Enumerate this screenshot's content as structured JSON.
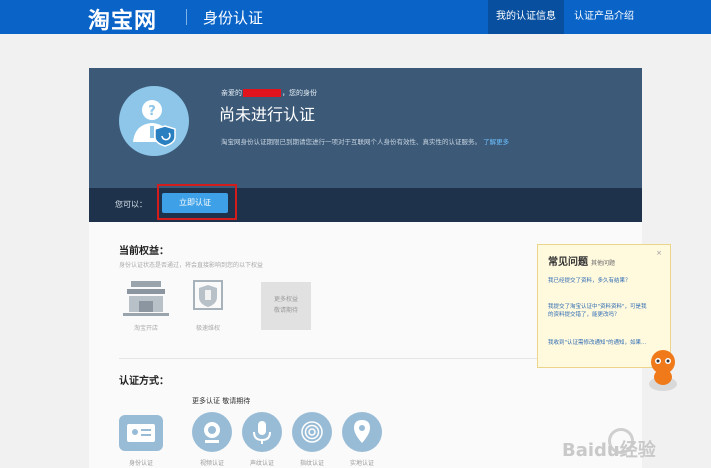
{
  "header": {
    "logo": "淘宝网",
    "subtitle": "身份认证",
    "nav": [
      "我的认证信息",
      "认证产品介绍"
    ],
    "brand_color": "#0a64c8"
  },
  "status": {
    "greeting_prefix": "亲爱的",
    "greeting_suffix": "，您的身份",
    "title": "尚未进行认证",
    "description": "淘宝网身份认证期限已到期请您进行一项对于互联网个人身份有效性、真实性的认证服务。",
    "more_link": "了解更多"
  },
  "action": {
    "label": "您可以：",
    "button": "立即认证"
  },
  "benefits": {
    "title": "当前权益：",
    "subtitle": "身份认证状态是否通过，将会直接影响到您的以下权益",
    "items": [
      "淘宝开店",
      "极速维权"
    ],
    "more_line1": "更多权益",
    "more_line2": "敬请期待"
  },
  "methods": {
    "title": "认证方式：",
    "more": "更多认证  敬请期待",
    "items": [
      "身份认证",
      "视频认证",
      "声纹认证",
      "指纹认证",
      "实地认证"
    ]
  },
  "faq": {
    "close": "×",
    "title": "常见问题",
    "title_sub": "其他问题",
    "items": [
      "我已经提交了资料，多久有结果？",
      "我提交了淘宝认证中\"资料资料\"，可是我的资料提交错了，能更改吗？",
      "我收到\"认证需修改通知\"的通知，如果…"
    ]
  },
  "watermark": "Baidu经验",
  "colors": {
    "card": "#3c5a78",
    "action_bar": "#1e334b",
    "button": "#3ea1e8",
    "highlight": "#d31d1d",
    "faq_bg": "#fff9de"
  },
  "icons": [
    "user-shield-icon",
    "shop-icon",
    "wrench-shield-icon",
    "id-card-icon",
    "camera-icon",
    "mic-icon",
    "fingerprint-icon",
    "location-pin-icon",
    "mascot-icon"
  ]
}
